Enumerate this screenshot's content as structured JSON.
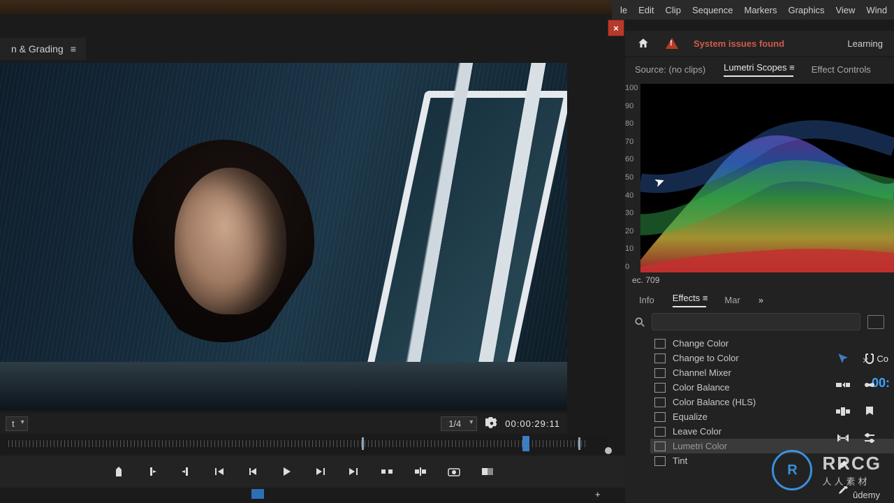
{
  "menubar": {
    "items": [
      "le",
      "Edit",
      "Clip",
      "Sequence",
      "Markers",
      "Graphics",
      "View",
      "Wind"
    ]
  },
  "header": {
    "system_issues": "System issues found",
    "learning": "Learning"
  },
  "workspace_tab": "n & Grading",
  "panel_tabs": {
    "source": "Source: (no clips)",
    "scopes": "Lumetri Scopes",
    "effect_controls": "Effect Controls"
  },
  "scope": {
    "y_ticks": [
      "100",
      "90",
      "80",
      "70",
      "60",
      "50",
      "40",
      "30",
      "20",
      "10",
      "0"
    ],
    "rec_label": "ec. 709"
  },
  "lower_tabs": {
    "info": "Info",
    "effects": "Effects",
    "mar": "Mar"
  },
  "search": {
    "placeholder": ""
  },
  "effects_list": [
    {
      "label": "Change Color",
      "selected": false
    },
    {
      "label": "Change to Color",
      "selected": false
    },
    {
      "label": "Channel Mixer",
      "selected": false
    },
    {
      "label": "Color Balance",
      "selected": false
    },
    {
      "label": "Color Balance (HLS)",
      "selected": false
    },
    {
      "label": "Equalize",
      "selected": false
    },
    {
      "label": "Leave Color",
      "selected": false
    },
    {
      "label": "Lumetri Color",
      "selected": true
    },
    {
      "label": "Tint",
      "selected": false
    }
  ],
  "monitor": {
    "resolution": "1/4",
    "timecode": "00:00:29:11",
    "fit": "t"
  },
  "project": {
    "co_label": "Co",
    "timecode": "00:"
  },
  "watermark": {
    "brand": "RRCG",
    "sub": "人人素材",
    "provider": "ûdemy"
  }
}
